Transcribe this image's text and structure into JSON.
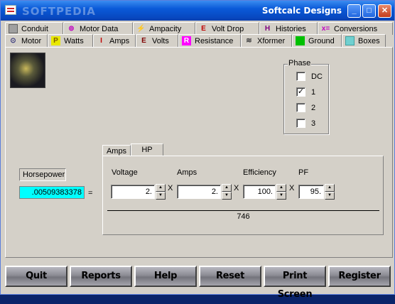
{
  "window": {
    "title": "Softcalc Designs",
    "watermark": "SOFTPEDIA"
  },
  "tabs_row1": [
    {
      "label": "Conduit",
      "icon": "conduit-icon",
      "color": "#808080"
    },
    {
      "label": "Motor Data",
      "icon": "motor-data-icon",
      "color": "#c000c0"
    },
    {
      "label": "Ampacity",
      "icon": "ampacity-icon",
      "color": "#d8c000"
    },
    {
      "label": "Volt Drop",
      "icon": "volt-drop-icon",
      "color": "#c00000"
    },
    {
      "label": "Histories",
      "icon": "histories-icon",
      "color": "#800080"
    },
    {
      "label": "Conversions",
      "icon": "conversions-icon",
      "color": "#c000c0"
    }
  ],
  "tabs_row2": [
    {
      "label": "Motor",
      "icon": "motor-icon",
      "color": "#404080",
      "active": true
    },
    {
      "label": "Watts",
      "icon": "watts-icon",
      "color": "#e0e000"
    },
    {
      "label": "Amps",
      "icon": "amps-icon",
      "color": "#c00000"
    },
    {
      "label": "Volts",
      "icon": "volts-icon",
      "color": "#800000"
    },
    {
      "label": "Resistance",
      "icon": "resistance-icon",
      "color": "#ff00ff"
    },
    {
      "label": "Xformer",
      "icon": "xformer-icon",
      "color": "#404040"
    },
    {
      "label": "Ground",
      "icon": "ground-icon",
      "color": "#00c000"
    },
    {
      "label": "Boxes",
      "icon": "boxes-icon",
      "color": "#40c0c0"
    }
  ],
  "phase": {
    "legend": "Phase",
    "options": [
      {
        "label": "DC",
        "checked": false
      },
      {
        "label": "1",
        "checked": true
      },
      {
        "label": "2",
        "checked": false
      },
      {
        "label": "3",
        "checked": false
      }
    ]
  },
  "subtabs": {
    "amps": "Amps",
    "hp": "HP"
  },
  "horsepower": {
    "label": "Horsepower",
    "value": ".00509383378",
    "equals": "="
  },
  "fields": {
    "voltage_label": "Voltage",
    "voltage": "2.",
    "amps_label": "Amps",
    "amps": "2.",
    "efficiency_label": "Efficiency",
    "efficiency": "100.",
    "pf_label": "PF",
    "pf": "95.",
    "times": "X"
  },
  "result": "746",
  "buttons": {
    "quit": "Quit",
    "reports": "Reports",
    "help": "Help",
    "reset": "Reset",
    "print_screen": "Print Screen",
    "register": "Register"
  }
}
